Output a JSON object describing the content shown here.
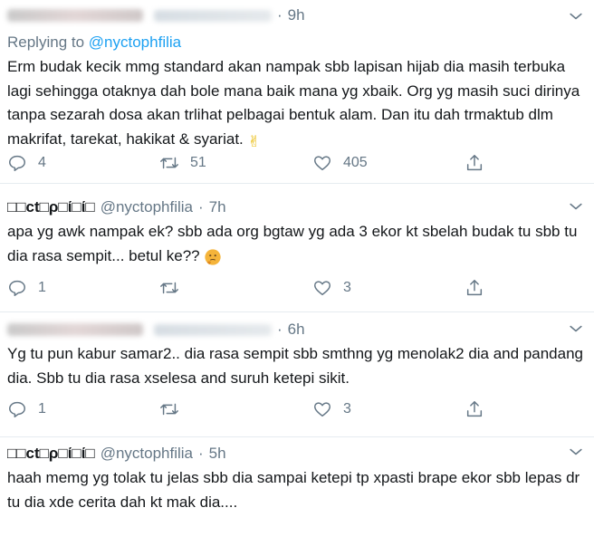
{
  "tweets": [
    {
      "name": "",
      "handle": "",
      "time": "9h",
      "replying_prefix": "Replying to",
      "replying_mention": "@nyctophfilia",
      "text": "Erm budak kecik mmg standard akan nampak sbb lapisan hijab dia masih terbuka lagi sehingga otaknya dah bole mana baik mana yg xbaik. Org yg masih suci dirinya tanpa sezarah dosa akan trlihat pelbagai bentuk alam. Dan itu dah trmaktub dlm makrifat, tarekat, hakikat & syariat.",
      "emoji": "✌",
      "replies": "4",
      "retweets": "51",
      "likes": "405"
    },
    {
      "name": "□□ct□ρ□ί□ί□",
      "handle": "@nyctophfilia",
      "time": "7h",
      "text": "apa yg awk nampak ek? sbb ada org bgtaw yg ada 3 ekor kt sbelah budak tu sbb tu dia rasa sempit... betul ke??",
      "emoji": "🤔",
      "replies": "1",
      "retweets": "",
      "likes": "3"
    },
    {
      "name": "",
      "handle": "",
      "time": "6h",
      "text": "Yg tu pun kabur samar2.. dia rasa sempit sbb smthng yg menolak2 dia and pandang dia. Sbb tu dia rasa xselesa and suruh ketepi sikit.",
      "replies": "1",
      "retweets": "",
      "likes": "3"
    },
    {
      "name": "□□ct□ρ□ί□ί□",
      "handle": "@nyctophfilia",
      "time": "5h",
      "text": "haah memg yg tolak tu jelas sbb dia sampai ketepi tp xpasti brape ekor sbb lepas dr tu dia xde cerita dah kt mak dia...."
    }
  ],
  "dot": "·",
  "icons": [
    "chevron-down-icon",
    "reply-icon",
    "retweet-icon",
    "like-icon",
    "share-icon"
  ],
  "colors": {
    "text": "#14171a",
    "muted": "#657786",
    "link": "#1da1f2",
    "divider": "#e6ecf0"
  }
}
